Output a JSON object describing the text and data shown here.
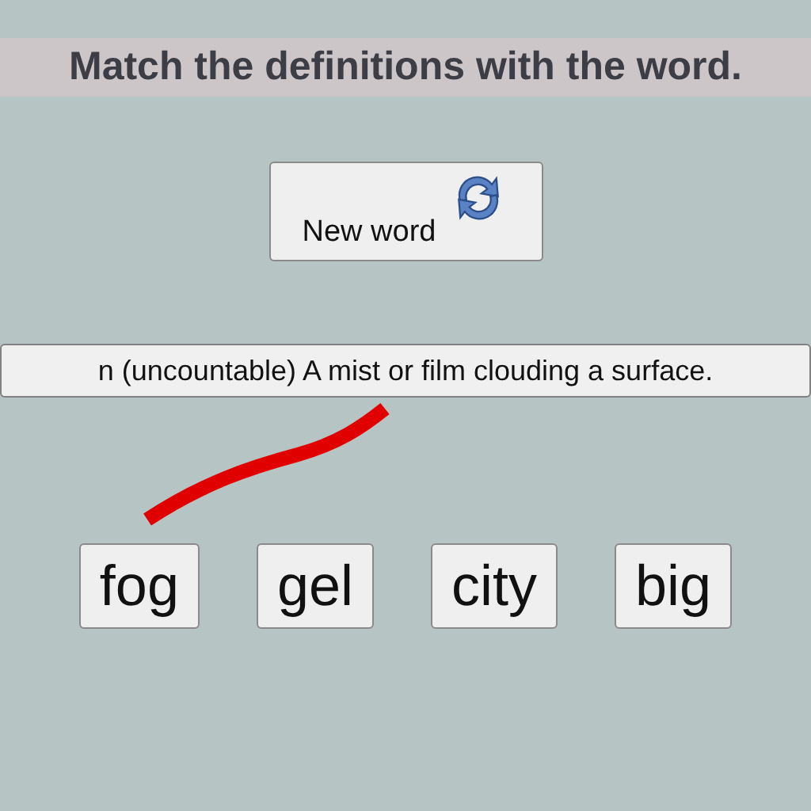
{
  "title": "Match the definitions with the word.",
  "new_word_button": {
    "label": "New word"
  },
  "definition": "n (uncountable) A mist or film clouding a surface.",
  "words": [
    {
      "label": "fog"
    },
    {
      "label": "gel"
    },
    {
      "label": "city"
    },
    {
      "label": "big"
    }
  ]
}
